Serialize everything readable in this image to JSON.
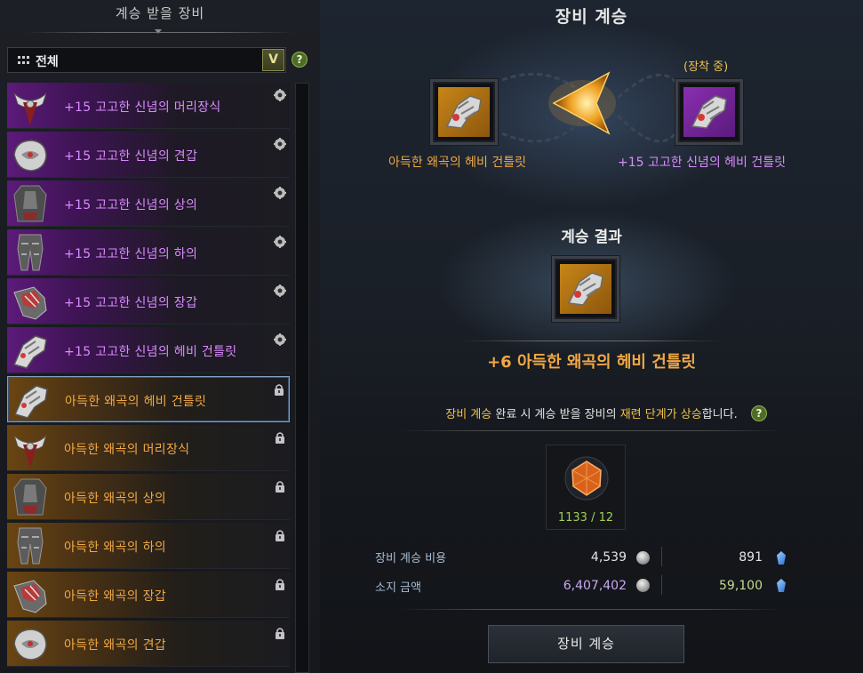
{
  "left_panel": {
    "title": "계승 받을 장비",
    "filter": {
      "selected": "전체",
      "dropdown_glyph": "V",
      "help": "?"
    },
    "items": [
      {
        "name": "+15 고고한 신념의 머리장식",
        "grade": "purple",
        "icon": "helmet-icon",
        "tag": "gear-icon"
      },
      {
        "name": "+15 고고한 신념의 견갑",
        "grade": "purple",
        "icon": "shoulder-icon",
        "tag": "gear-icon"
      },
      {
        "name": "+15 고고한 신념의 상의",
        "grade": "purple",
        "icon": "chest-armor-icon",
        "tag": "gear-icon"
      },
      {
        "name": "+15 고고한 신념의 하의",
        "grade": "purple",
        "icon": "leg-armor-icon",
        "tag": "gear-icon"
      },
      {
        "name": "+15 고고한 신념의 장갑",
        "grade": "purple",
        "icon": "glove-icon",
        "tag": "gear-icon"
      },
      {
        "name": "+15 고고한 신념의 헤비 건틀릿",
        "grade": "purple",
        "icon": "gauntlet-icon",
        "tag": "gear-icon"
      },
      {
        "name": "아득한 왜곡의 헤비 건틀릿",
        "grade": "orange",
        "icon": "gauntlet-icon",
        "tag": "lock-icon",
        "selected": true
      },
      {
        "name": "아득한 왜곡의 머리장식",
        "grade": "orange",
        "icon": "helmet-icon",
        "tag": "lock-icon"
      },
      {
        "name": "아득한 왜곡의 상의",
        "grade": "orange",
        "icon": "chest-armor-icon",
        "tag": "lock-icon"
      },
      {
        "name": "아득한 왜곡의 하의",
        "grade": "orange",
        "icon": "leg-armor-icon",
        "tag": "lock-icon"
      },
      {
        "name": "아득한 왜곡의 장갑",
        "grade": "orange",
        "icon": "glove-icon",
        "tag": "lock-icon"
      },
      {
        "name": "아득한 왜곡의 견갑",
        "grade": "orange",
        "icon": "shoulder-icon",
        "tag": "lock-icon"
      }
    ]
  },
  "main": {
    "title": "장비 계승",
    "source_label": "아득한 왜곡의 헤비 건틀릿",
    "target_equipped": "(장착 중)",
    "target_label": "+15 고고한 신념의 헤비 건틀릿",
    "result_title": "계승 결과",
    "result_name": "+6 아득한 왜곡의 헤비 건틀릿",
    "notice": {
      "part1": "장비 계승",
      "part2": " 완료 시 계승 받을 장비의 ",
      "part3": "재련 단계가 상승",
      "part4": "합니다.",
      "help": "?"
    },
    "material_count": "1133 / 12",
    "cost_label": "장비 계승 비용",
    "cost_silver": "4,539",
    "cost_crystal": "891",
    "owned_label": "소지 금액",
    "owned_silver": "6,407,402",
    "owned_crystal": "59,100",
    "button": "장비 계승"
  },
  "colors": {
    "purple_grade": "#d98bff",
    "orange_grade": "#f0a845",
    "highlight": "#f2c14a",
    "material_count": "#9fcf5a"
  }
}
